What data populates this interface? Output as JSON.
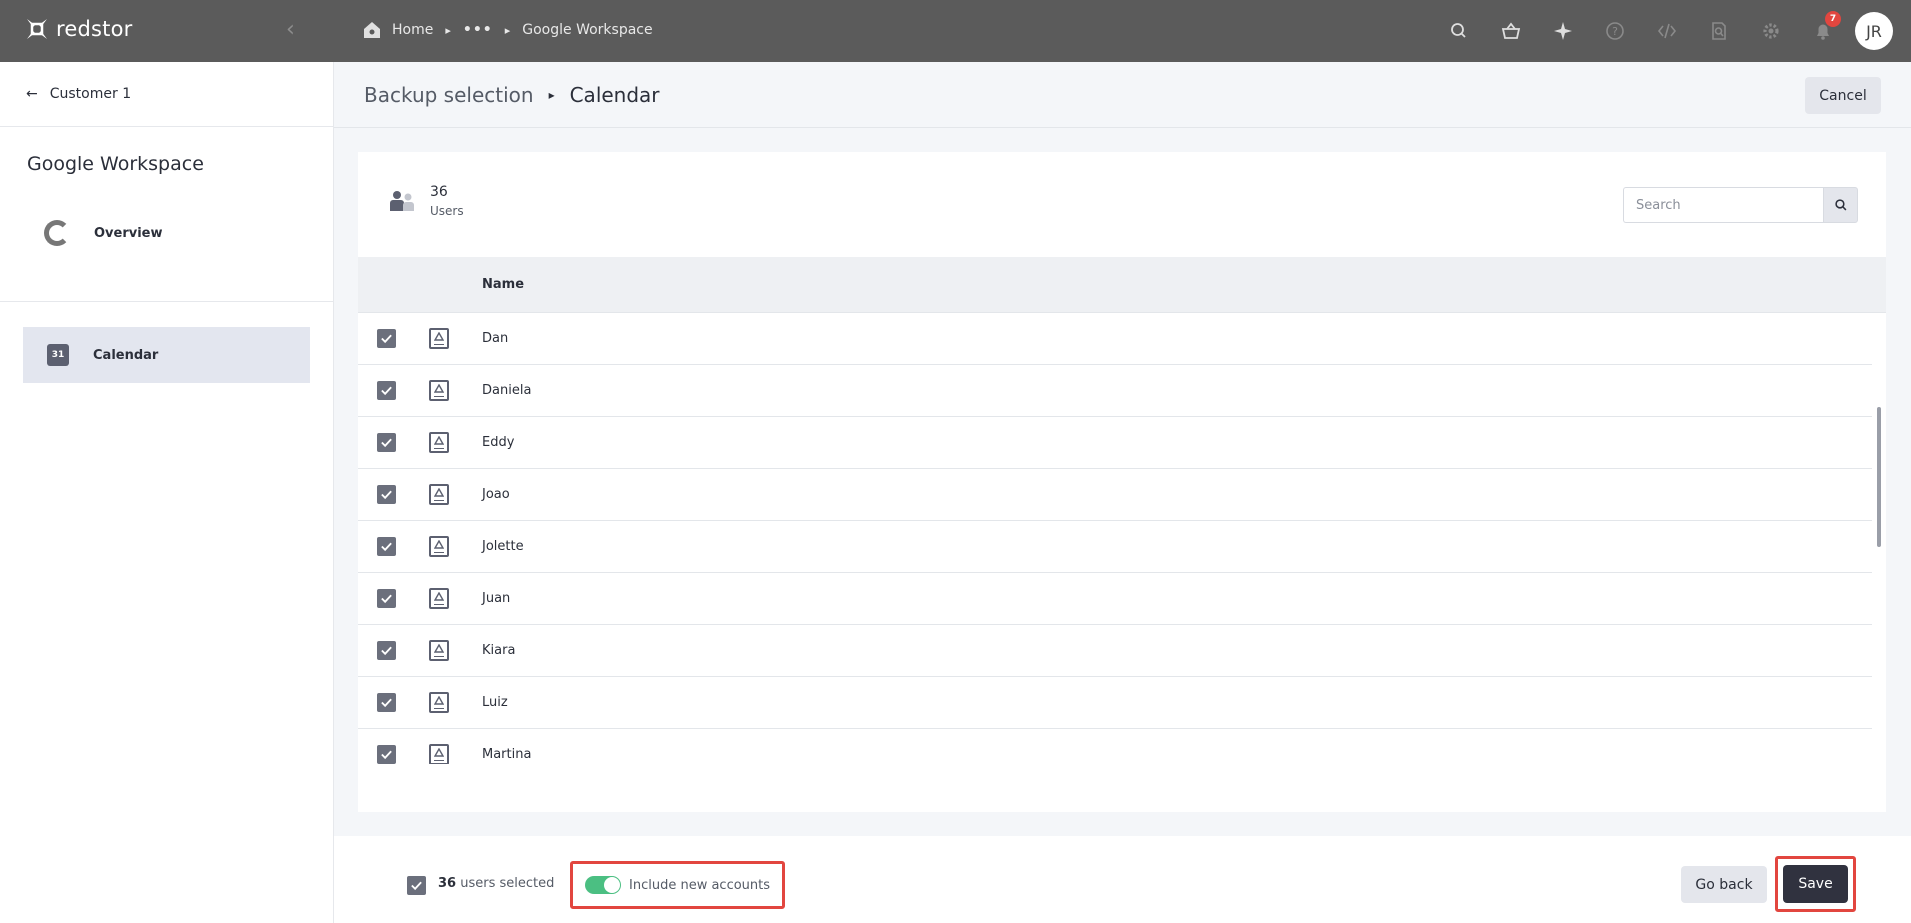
{
  "topbar": {
    "brand": "redstor",
    "breadcrumb": {
      "home": "Home",
      "ellipsis": "•••",
      "current": "Google Workspace"
    },
    "notifications_count": "7",
    "avatar_initials": "JR"
  },
  "sidebar": {
    "back_label": "Customer 1",
    "title": "Google Workspace",
    "items": [
      {
        "label": "Overview"
      },
      {
        "label": "Calendar",
        "active": true,
        "icon_text": "31"
      }
    ]
  },
  "header": {
    "breadcrumb_parent": "Backup selection",
    "breadcrumb_current": "Calendar",
    "cancel_label": "Cancel"
  },
  "summary": {
    "count": "36",
    "label": "Users"
  },
  "search": {
    "placeholder": "Search",
    "value": ""
  },
  "table": {
    "columns": [
      "Name"
    ],
    "rows": [
      {
        "name": "Dan",
        "checked": true
      },
      {
        "name": "Daniela",
        "checked": true
      },
      {
        "name": "Eddy",
        "checked": true
      },
      {
        "name": "Joao",
        "checked": true
      },
      {
        "name": "Jolette",
        "checked": true
      },
      {
        "name": "Juan",
        "checked": true
      },
      {
        "name": "Kiara",
        "checked": true
      },
      {
        "name": "Luiz",
        "checked": true
      },
      {
        "name": "Martina",
        "checked": true
      }
    ]
  },
  "footer": {
    "selected_count": "36",
    "selected_suffix": "users selected",
    "include_new_label": "Include new accounts",
    "include_new_on": true,
    "go_back_label": "Go back",
    "save_label": "Save"
  },
  "colors": {
    "topbar": "#5b5b5b",
    "accent_dark": "#30323f",
    "highlight_red": "#e2463f",
    "toggle_green": "#4bbf82"
  }
}
